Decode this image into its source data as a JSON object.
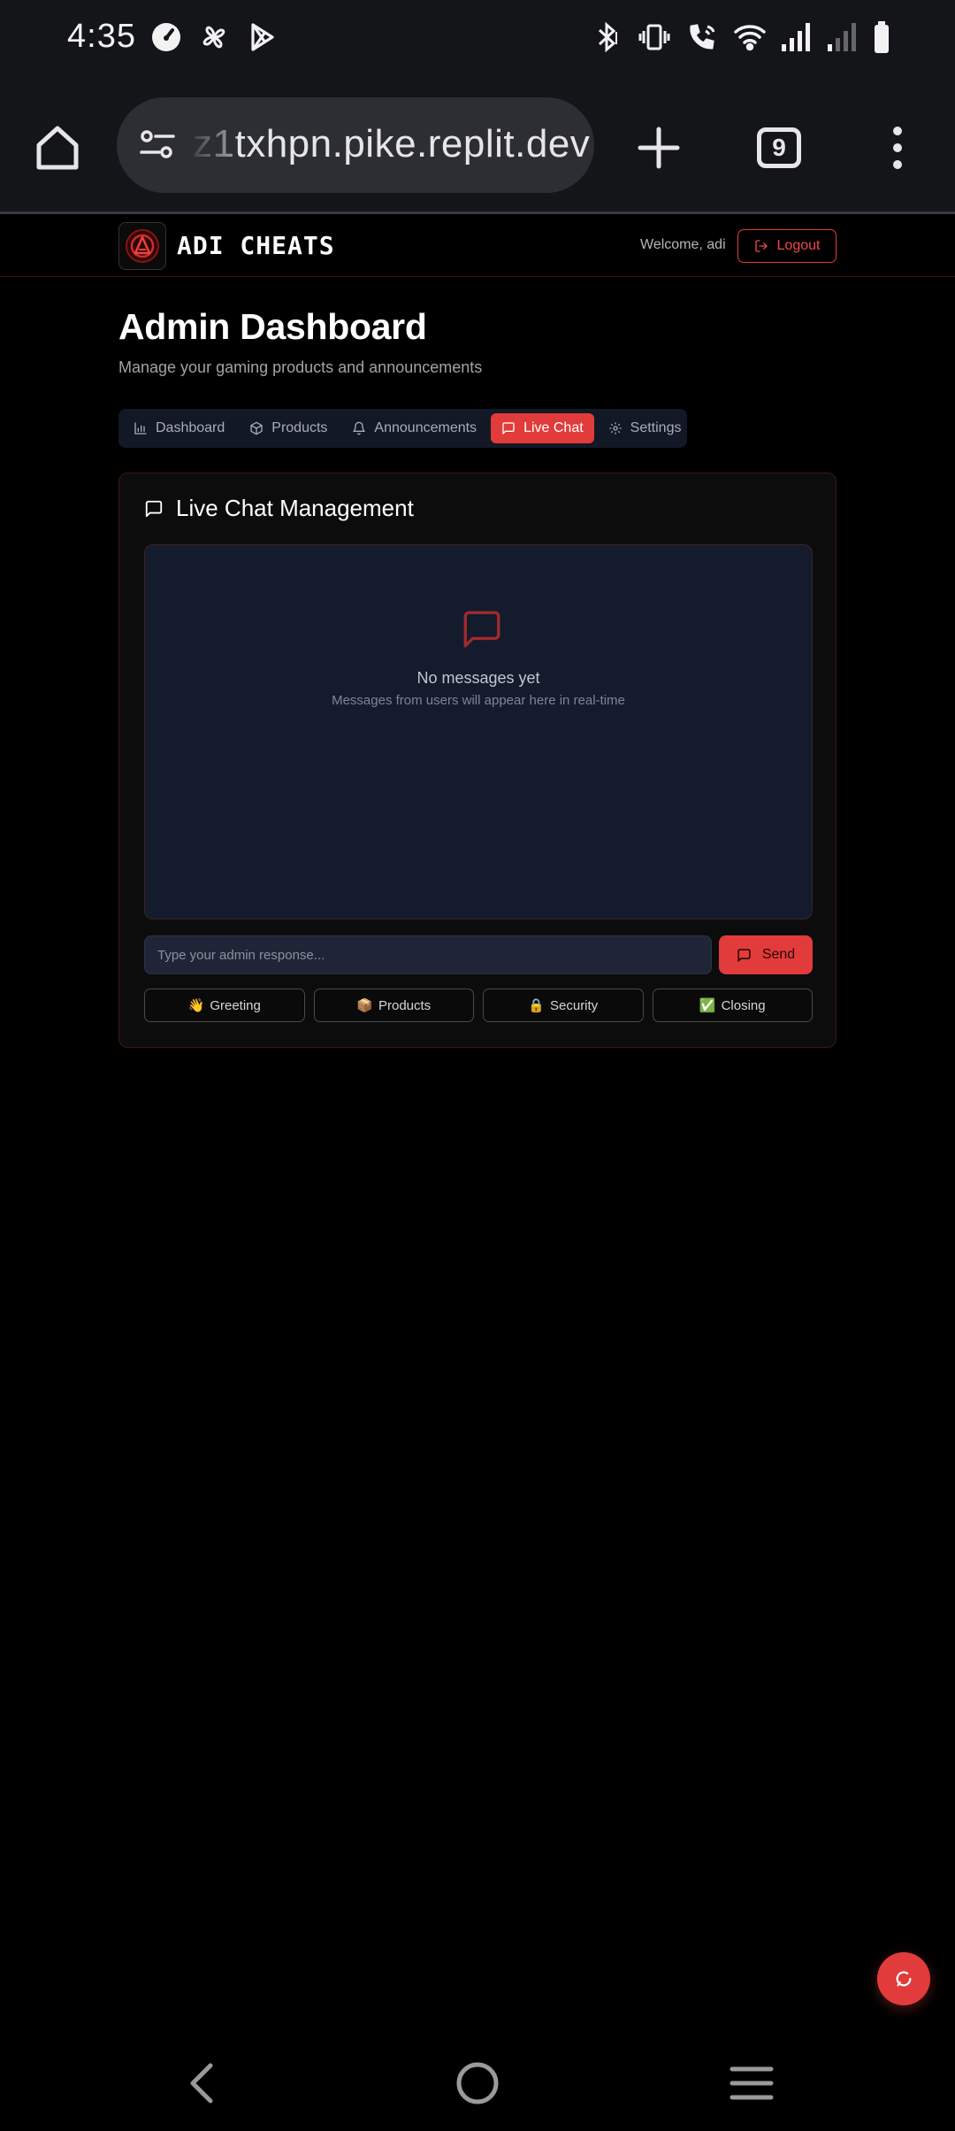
{
  "status_bar": {
    "time": "4:35",
    "left_icons": [
      "speedometer-icon",
      "pinwheel-icon",
      "play-store-icon"
    ],
    "right_icons": [
      "bluetooth-icon",
      "vibrate-icon",
      "wifi-calling-icon",
      "wifi-icon",
      "signal-icon",
      "signal-weak-icon",
      "battery-icon"
    ]
  },
  "browser": {
    "url": "z1txhpn.pike.replit.dev",
    "tab_count": "9"
  },
  "header": {
    "brand": "ADI CHEATS",
    "welcome": "Welcome, adi",
    "logout_label": "Logout"
  },
  "page": {
    "title": "Admin Dashboard",
    "subtitle": "Manage your gaming products and announcements"
  },
  "tabs": [
    {
      "label": "Dashboard",
      "icon": "bar-chart-icon",
      "active": false
    },
    {
      "label": "Products",
      "icon": "package-icon",
      "active": false
    },
    {
      "label": "Announcements",
      "icon": "bell-icon",
      "active": false
    },
    {
      "label": "Live Chat",
      "icon": "message-square-icon",
      "active": true
    },
    {
      "label": "Settings",
      "icon": "gear-icon",
      "active": false
    }
  ],
  "live_chat": {
    "title": "Live Chat Management",
    "empty_title": "No messages yet",
    "empty_subtitle": "Messages from users will appear here in real-time",
    "input_placeholder": "Type your admin response...",
    "send_label": "Send",
    "quick_replies": [
      {
        "emoji": "👋",
        "label": "Greeting"
      },
      {
        "emoji": "📦",
        "label": "Products"
      },
      {
        "emoji": "🔒",
        "label": "Security"
      },
      {
        "emoji": "✅",
        "label": "Closing"
      }
    ]
  },
  "colors": {
    "accent": "#e23b3b",
    "background": "#000000",
    "card": "#0c0c0c",
    "chat_area": "#141b2d"
  }
}
